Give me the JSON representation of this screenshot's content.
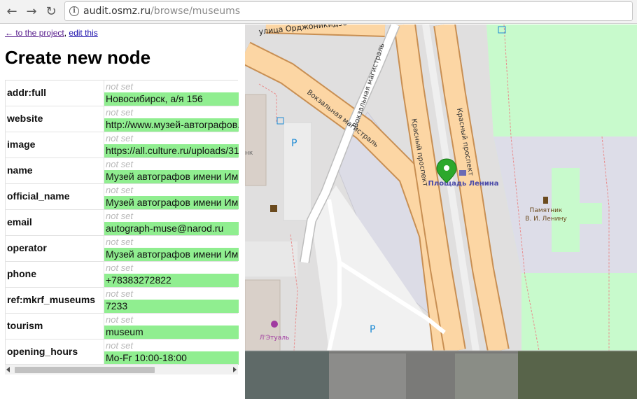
{
  "browser": {
    "url_host": "audit.osmz.ru",
    "url_path": "/browse/museums"
  },
  "links": {
    "back_to_project": "← to the project",
    "separator": ",",
    "edit_this": "edit this"
  },
  "page_title": "Create new node",
  "not_set_label": "not set",
  "tags": [
    {
      "key": "addr:full",
      "value": "Новосибирск, а/я 156"
    },
    {
      "key": "website",
      "value": "http://www.музей-автографов.рф"
    },
    {
      "key": "image",
      "value": "https://all.culture.ru/uploads/31"
    },
    {
      "key": "name",
      "value": "Музей автографов имени Им"
    },
    {
      "key": "official_name",
      "value": "Музей автографов имени Им"
    },
    {
      "key": "email",
      "value": "autograph-muse@narod.ru"
    },
    {
      "key": "operator",
      "value": "Музей автографов имени Им"
    },
    {
      "key": "phone",
      "value": "+78383272822"
    },
    {
      "key": "ref:mkrf_museums",
      "value": "7233"
    },
    {
      "key": "tourism",
      "value": "museum"
    },
    {
      "key": "opening_hours",
      "value": "Mo-Fr 10:00-18:00"
    }
  ],
  "map": {
    "labels": {
      "street_top": "улица Орджоникидзе",
      "vokzalnaya_1": "Вокзальная магистраль",
      "vokzalnaya_2": "Вокзальная магистраль",
      "krasny_1": "Красный проспект",
      "krasny_2": "Красный проспект",
      "square": "Площадь Ленина",
      "monument_1": "Памятник",
      "monument_2": "В. И. Ленину",
      "shop": "Л'Этуаль",
      "bank_fragment": "нк",
      "parking": "P"
    },
    "colors": {
      "trunk_road": "#fcd6a4",
      "trunk_casing": "#c88f53",
      "park": "#c8facc",
      "plaza": "#dddde8",
      "marker": "#2ca82c",
      "parking_text": "#1e8bd4"
    }
  }
}
